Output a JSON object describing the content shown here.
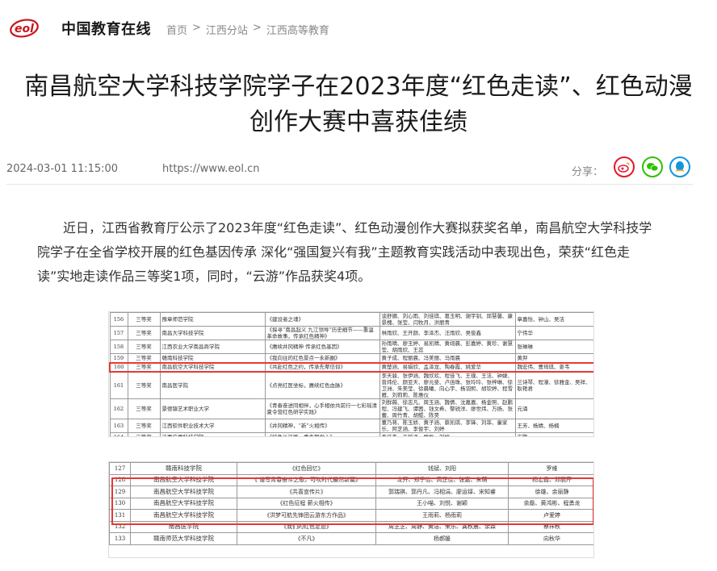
{
  "site": {
    "logo_mark": "eol",
    "logo_text": "中国教育在线",
    "breadcrumb": [
      "首页",
      "江西分站",
      "江西高等教育"
    ],
    "breadcrumb_sep": ">"
  },
  "article": {
    "title": "南昌航空大学科技学院学子在2023年度“红色走读”、红色动漫创作大赛中喜获佳绩",
    "date": "2024-03-01 11:15:00",
    "source_url": "https://www.eol.cn",
    "share_label": "分享：",
    "share_icons": [
      "weibo-icon",
      "wechat-icon",
      "qzone-icon"
    ],
    "paragraph": "近日，江西省教育厅公示了2023年度“红色走读”、红色动漫创作大赛拟获奖名单，南昌航空大学科技学院学子在全省学校开展的红色基因传承 深化“强国复兴有我”主题教育实践活动中表现出色，荣获“红色走读”实地走读作品三等奖1项，同时，“云游”作品获奖4项。"
  },
  "table1": {
    "rows": [
      {
        "no": "156",
        "prize": "三等奖",
        "school": "豫章师范学院",
        "work": "《建设者之魂》",
        "members": "谈舒娜、刘心雨、刘佳琪、葛玉明、谢宇钏、邱慧馨、康景槐、张莹、闫牧月、洪丽青",
        "teacher": "章嘉怡、钟山、吴洁",
        "size": "r-double"
      },
      {
        "no": "157",
        "prize": "三等奖",
        "school": "南昌大学科技学院",
        "work": "《探寻“南昌起义 九江领导”历史细节——重温革命故事，传承红色精神》",
        "members": "林雨欣、王开颜、李泽杰、汪雨欣、吴俊鑫",
        "teacher": "宁伟华",
        "size": "r-double"
      },
      {
        "no": "158",
        "prize": "三等奖",
        "school": "江西农业大学南昌商学院",
        "work": "《赓续井冈精神 传承红色基因》",
        "members": "孙雨晴、廖玉婷、易凯晴、黄翊晨、彭嘉婷、黄珍、谢慧莹、胡雨欣、王蕊",
        "teacher": "张琳琳",
        "size": "r-double"
      },
      {
        "no": "159",
        "prize": "三等奖",
        "school": "赣南科技学院",
        "work": "《我向往的红色景点一永新圈》",
        "members": "黄子成、程丽晨、冯美丽、马雨晨",
        "teacher": "黄羿",
        "size": "r-single"
      },
      {
        "no": "160",
        "prize": "三等奖",
        "school": "南昌航空大学科技学院",
        "work": "《共赴红色之约，传承先辈信仰》",
        "members": "黄楚涵、易娟欣、孟泽龙、陶春霞、姚爱华",
        "teacher": "魏宏伟、曹琦琪、姜韦",
        "size": "r-single",
        "highlight": true
      },
      {
        "no": "161",
        "prize": "三等奖",
        "school": "南昌医学院",
        "work": "《点亮红医坐标，赓续红色血脉》",
        "members": "李天骏、张伊涵、魏欣欢、程佳飞、王璞、王洁、钟婕、曾炜伦、颜亚天、廖元斐、卢函珠、张玲玲、张梓琳、徐卫洲、朱美莹、徐晨曦、向心宇、杨羽熙、胡钦婷、程雪雁、刘莉莉、陈惠仪",
        "teacher": "兰诗琴、程濠、徐雅金、吴祥、耿艳君",
        "size": "r-triple"
      },
      {
        "no": "162",
        "prize": "三等奖",
        "school": "景德镇艺术职业大学",
        "work": "《青春奋进同相伴，心手相依共前行一七彩瑶清夏令营红色研学实践》",
        "members": "刘鲜薇、徐志凡、周玉涵、魏倩、沈嘉嘉、杨金照、赵鹏程、冯建飞、谭茜、钱文希、黎锐洋、廖世炜、万扬、张蕾、周竹青、胡鲲、陈昊",
        "teacher": "元涌",
        "size": "r-triple"
      },
      {
        "no": "163",
        "prize": "三等奖",
        "school": "江西软件职业技术大学",
        "work": "《井冈精神，“新”火相传》",
        "members": "董乃蒋、陈玉娇、黄子涵、蔡凯琪、李锋、刘菲、童家乐、阿芝涵、李俊宇、刘婷",
        "teacher": "王芳、杨婧、杨楠",
        "size": "r-double"
      },
      {
        "no": "164",
        "prize": "三等奖",
        "school": "江西应用科技学院",
        "work": "《红色长征路，青春聚党心》",
        "members": "李佳鑫、王铭泽、罗磊、刘婷",
        "teacher": "方鹏",
        "size": "r-single"
      }
    ]
  },
  "table2": {
    "rows": [
      {
        "no": "127",
        "school": "赣南科技学院",
        "work": "《红色回忆》",
        "members": "钱斌、刘阳",
        "teacher": "罗维"
      },
      {
        "no": "128",
        "school": "南昌航空大学科技学院",
        "work": "《 谱写青春奋斗之歌，可吹时代最然新篇》",
        "members": "龙开、郑子怡、高正佳、张嘉、朱萌",
        "teacher": "杨宏霞、邓丽芹"
      },
      {
        "no": "129",
        "school": "南昌航空大学科技学院",
        "work": "《共喜宣传片》",
        "members": "郭瑞祺、郭丹凡、冯相涓、廖运铎、宋知睿",
        "teacher": "徐雄、余丽静"
      },
      {
        "no": "130",
        "school": "南昌航空大学科技学院",
        "work": "《红色征程 薪火相传》",
        "members": "王小喵、刘悦、谢颖",
        "teacher": "余磊、黄鸿彬、程勇龙"
      },
      {
        "no": "131",
        "school": "南昌航空大学科技学院",
        "work": "《洪梦可航先锋团云游东方作品》",
        "members": "王雨莉、杨雨莉",
        "teacher": "卢爱婷"
      },
      {
        "no": "132",
        "school": "南昌医学院",
        "work": "《我们的红色足迹》",
        "members": "周芝芝、周静、黄洁、荣乐、龚秋晨、余霖",
        "teacher": "蔡祥秋"
      },
      {
        "no": "133",
        "school": "赣南师范大学科技学院",
        "work": "《不凡》",
        "members": "杨郝媛",
        "teacher": "向秋华"
      }
    ]
  },
  "colors": {
    "highlight": "#e53935",
    "brand_red": "#c8161d",
    "weibo": "#e6162d",
    "wechat": "#2dc100",
    "qzone": "#1296db"
  }
}
